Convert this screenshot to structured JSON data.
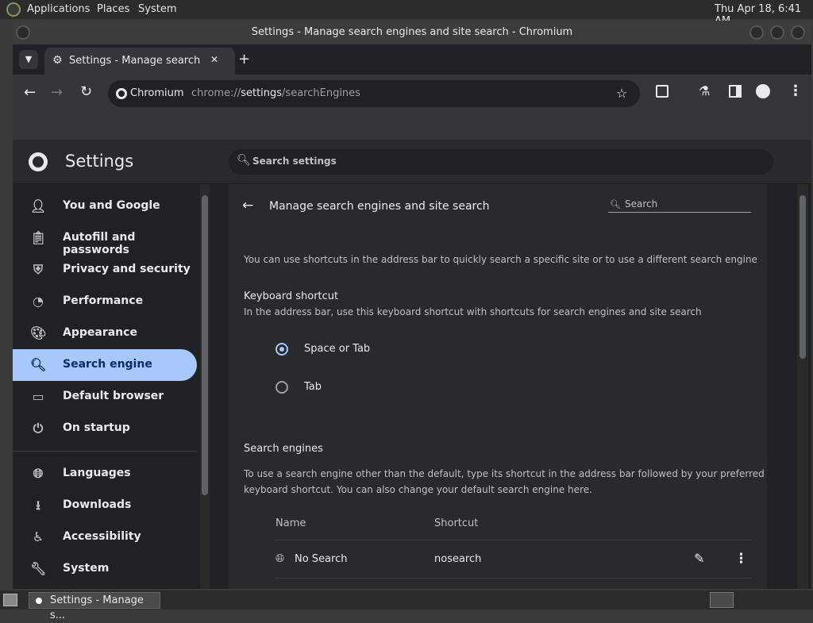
{
  "panel": {
    "menus": [
      "Applications",
      "Places",
      "System"
    ],
    "clock": "Thu Apr 18,  6:41 AM"
  },
  "window": {
    "title": "Settings - Manage search engines and site search - Chromium"
  },
  "tab": {
    "title": "Settings - Manage search en",
    "new_tab": "+",
    "close": "✕"
  },
  "omnibox": {
    "site_label": "Chromium",
    "url_prefix": "chrome://",
    "url_host": "settings",
    "url_path": "/searchEngines"
  },
  "settings": {
    "title": "Settings",
    "search_placeholder": "Search settings",
    "nav": [
      {
        "label": "You and Google",
        "icon": "person-icon"
      },
      {
        "label": "Autofill and passwords",
        "icon": "clipboard-icon"
      },
      {
        "label": "Privacy and security",
        "icon": "shield-icon"
      },
      {
        "label": "Performance",
        "icon": "speedometer-icon"
      },
      {
        "label": "Appearance",
        "icon": "palette-icon"
      },
      {
        "label": "Search engine",
        "icon": "search-icon"
      },
      {
        "label": "Default browser",
        "icon": "browser-icon"
      },
      {
        "label": "On startup",
        "icon": "power-icon"
      },
      {
        "label": "Languages",
        "icon": "globe-icon"
      },
      {
        "label": "Downloads",
        "icon": "download-icon"
      },
      {
        "label": "Accessibility",
        "icon": "accessibility-icon"
      },
      {
        "label": "System",
        "icon": "wrench-icon"
      }
    ],
    "active_nav": "Search engine"
  },
  "page": {
    "title": "Manage search engines and site search",
    "search_placeholder": "Search",
    "intro": "You can use shortcuts in the address bar to quickly search a specific site or to use a different search engine",
    "keyboard_heading": "Keyboard shortcut",
    "keyboard_desc": "In the address bar, use this keyboard shortcut with shortcuts for search engines and site search",
    "options": [
      {
        "label": "Space or Tab",
        "selected": true
      },
      {
        "label": "Tab",
        "selected": false
      }
    ],
    "engines_heading": "Search engines",
    "engines_desc_1": "To use a search engine other than the default, type its shortcut in the address bar followed by your preferred",
    "engines_desc_2": "keyboard shortcut. You can also change your default search engine here.",
    "col_name": "Name",
    "col_shortcut": "Shortcut",
    "rows": [
      {
        "name": "No Search",
        "shortcut": "nosearch"
      }
    ]
  },
  "taskbar": {
    "task_label": "Settings - Manage s..."
  },
  "colors": {
    "accent": "#a8c7fa",
    "bg": "#202124",
    "card": "#292a2d"
  }
}
